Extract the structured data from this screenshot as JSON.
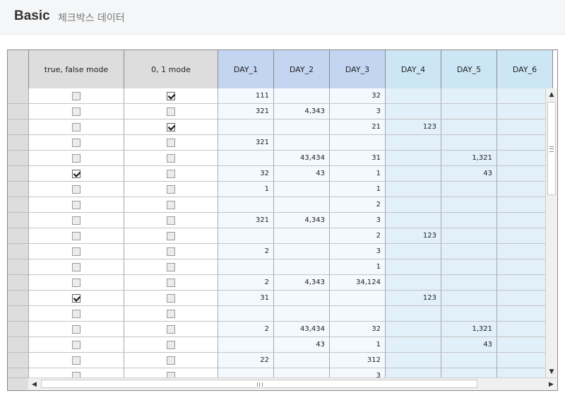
{
  "header": {
    "title": "Basic",
    "subtitle": "체크박스 데이터"
  },
  "grid": {
    "columns": [
      {
        "key": "row_header",
        "label": "",
        "width": 30,
        "kind": "rowhead"
      },
      {
        "key": "bool",
        "label": "true, false mode",
        "width": 135,
        "kind": "check"
      },
      {
        "key": "num",
        "label": "0, 1 mode",
        "width": 133,
        "kind": "check"
      },
      {
        "key": "DAY_1",
        "label": "DAY_1",
        "width": 79,
        "kind": "blue1"
      },
      {
        "key": "DAY_2",
        "label": "DAY_2",
        "width": 79,
        "kind": "blue1"
      },
      {
        "key": "DAY_3",
        "label": "DAY_3",
        "width": 79,
        "kind": "blue1"
      },
      {
        "key": "DAY_4",
        "label": "DAY_4",
        "width": 79,
        "kind": "blue2"
      },
      {
        "key": "DAY_5",
        "label": "DAY_5",
        "width": 79,
        "kind": "blue2"
      },
      {
        "key": "DAY_6",
        "label": "DAY_6",
        "width": 79,
        "kind": "blue2"
      }
    ],
    "rows": [
      {
        "bool": false,
        "num": true,
        "DAY_1": "111",
        "DAY_2": "",
        "DAY_3": "32",
        "DAY_4": "",
        "DAY_5": "",
        "DAY_6": ""
      },
      {
        "bool": false,
        "num": false,
        "DAY_1": "321",
        "DAY_2": "4,343",
        "DAY_3": "3",
        "DAY_4": "",
        "DAY_5": "",
        "DAY_6": ""
      },
      {
        "bool": false,
        "num": true,
        "DAY_1": "",
        "DAY_2": "",
        "DAY_3": "21",
        "DAY_4": "123",
        "DAY_5": "",
        "DAY_6": ""
      },
      {
        "bool": false,
        "num": false,
        "DAY_1": "321",
        "DAY_2": "",
        "DAY_3": "",
        "DAY_4": "",
        "DAY_5": "",
        "DAY_6": ""
      },
      {
        "bool": false,
        "num": false,
        "DAY_1": "",
        "DAY_2": "43,434",
        "DAY_3": "31",
        "DAY_4": "",
        "DAY_5": "1,321",
        "DAY_6": ""
      },
      {
        "bool": true,
        "num": false,
        "DAY_1": "32",
        "DAY_2": "43",
        "DAY_3": "1",
        "DAY_4": "",
        "DAY_5": "43",
        "DAY_6": ""
      },
      {
        "bool": false,
        "num": false,
        "DAY_1": "1",
        "DAY_2": "",
        "DAY_3": "1",
        "DAY_4": "",
        "DAY_5": "",
        "DAY_6": ""
      },
      {
        "bool": false,
        "num": false,
        "DAY_1": "",
        "DAY_2": "",
        "DAY_3": "2",
        "DAY_4": "",
        "DAY_5": "",
        "DAY_6": ""
      },
      {
        "bool": false,
        "num": false,
        "DAY_1": "321",
        "DAY_2": "4,343",
        "DAY_3": "3",
        "DAY_4": "",
        "DAY_5": "",
        "DAY_6": ""
      },
      {
        "bool": false,
        "num": false,
        "DAY_1": "",
        "DAY_2": "",
        "DAY_3": "2",
        "DAY_4": "123",
        "DAY_5": "",
        "DAY_6": ""
      },
      {
        "bool": false,
        "num": false,
        "DAY_1": "2",
        "DAY_2": "",
        "DAY_3": "3",
        "DAY_4": "",
        "DAY_5": "",
        "DAY_6": ""
      },
      {
        "bool": false,
        "num": false,
        "DAY_1": "",
        "DAY_2": "",
        "DAY_3": "1",
        "DAY_4": "",
        "DAY_5": "",
        "DAY_6": ""
      },
      {
        "bool": false,
        "num": false,
        "DAY_1": "2",
        "DAY_2": "4,343",
        "DAY_3": "34,124",
        "DAY_4": "",
        "DAY_5": "",
        "DAY_6": ""
      },
      {
        "bool": true,
        "num": false,
        "DAY_1": "31",
        "DAY_2": "",
        "DAY_3": "",
        "DAY_4": "123",
        "DAY_5": "",
        "DAY_6": ""
      },
      {
        "bool": false,
        "num": false,
        "DAY_1": "",
        "DAY_2": "",
        "DAY_3": "",
        "DAY_4": "",
        "DAY_5": "",
        "DAY_6": ""
      },
      {
        "bool": false,
        "num": false,
        "DAY_1": "2",
        "DAY_2": "43,434",
        "DAY_3": "32",
        "DAY_4": "",
        "DAY_5": "1,321",
        "DAY_6": ""
      },
      {
        "bool": false,
        "num": false,
        "DAY_1": "",
        "DAY_2": "43",
        "DAY_3": "1",
        "DAY_4": "",
        "DAY_5": "43",
        "DAY_6": ""
      },
      {
        "bool": false,
        "num": false,
        "DAY_1": "22",
        "DAY_2": "",
        "DAY_3": "312",
        "DAY_4": "",
        "DAY_5": "",
        "DAY_6": ""
      },
      {
        "bool": false,
        "num": false,
        "DAY_1": "",
        "DAY_2": "",
        "DAY_3": "3",
        "DAY_4": "",
        "DAY_5": "",
        "DAY_6": ""
      }
    ]
  },
  "icons": {
    "scroll_up": "▲",
    "scroll_down": "▼",
    "scroll_left": "◀",
    "scroll_right": "▶"
  },
  "colors": {
    "header_gray": "#dddddd",
    "day_header_1": "#c4d5f1",
    "day_header_2": "#cde6f6",
    "day_cell_1": "#f4f9ff",
    "day_cell_2": "#e1f0f9"
  }
}
